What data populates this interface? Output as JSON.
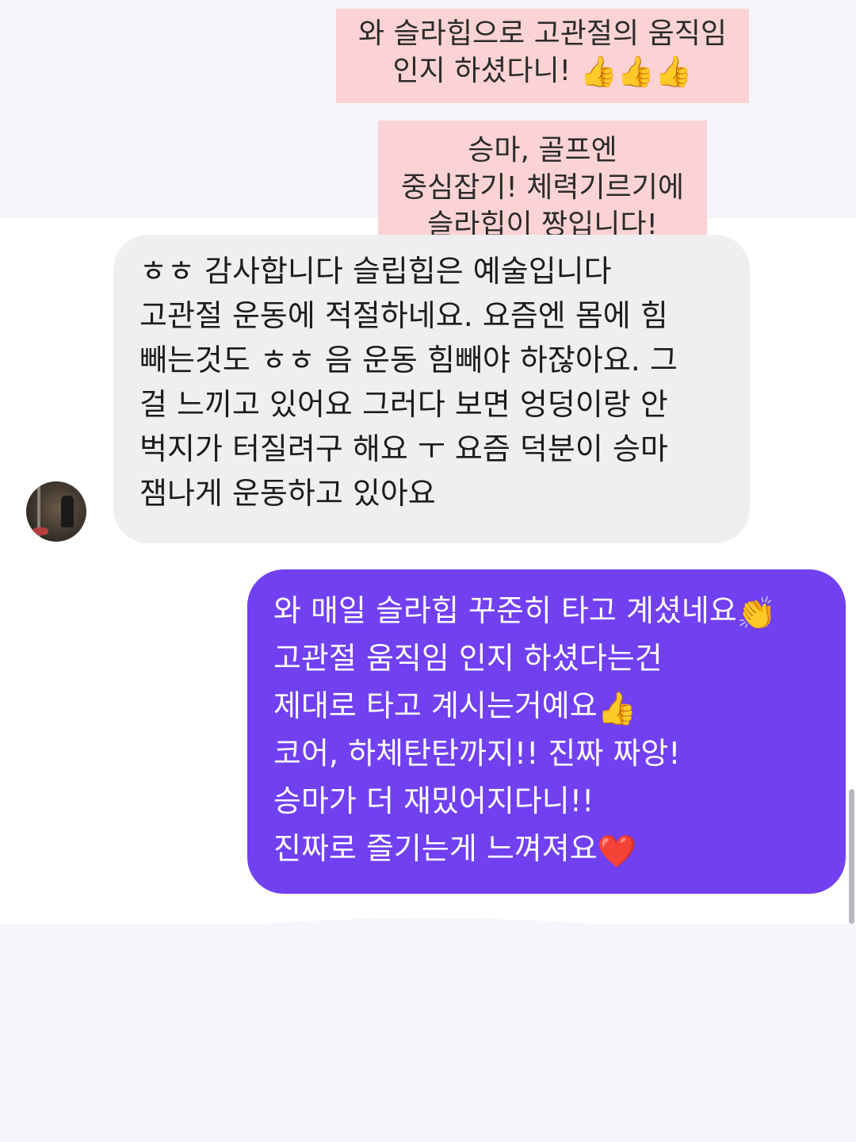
{
  "notes": [
    {
      "lines": [
        "와 슬라힙으로 고관절의 움직임",
        "인지 하셨다니!"
      ],
      "emoji": "👍👍👍"
    },
    {
      "lines": [
        "승마, 골프엔",
        "중심잡기!  체력기르기에",
        "슬라힙이 짱입니다!"
      ]
    }
  ],
  "incoming": {
    "avatar_icon": "user-avatar-photo",
    "lines": [
      "ㅎㅎ 감사합니다 슬립힙은 예술입니다",
      "고관절 운동에 적절하네요. 요즘엔 몸에 힘",
      "빼는것도 ㅎㅎ  음 운동 힘빼야 하잖아요. 그",
      "걸 느끼고 있어요 그러다 보면 엉덩이랑 안",
      "벅지가 터질려구 해요 ㅜ 요즘 덕분이 승마",
      "잼나게 운동하고 있아요"
    ]
  },
  "outgoing": {
    "lines": [
      {
        "text": "와 매일 슬라힙 꾸준히 타고 계셨네요",
        "emoji": "👏"
      },
      {
        "text": "고관절 움직임 인지 하셨다는건",
        "emoji": ""
      },
      {
        "text": "제대로 타고 계시는거예요",
        "emoji": "👍"
      },
      {
        "text": "코어, 하체탄탄까지!! 진짜 짜앙!",
        "emoji": ""
      },
      {
        "text": "승마가 더 재밌어지다니!!",
        "emoji": ""
      },
      {
        "text": "진짜로 즐기는게 느껴져요",
        "emoji": "❤️"
      }
    ]
  },
  "colors": {
    "note_bg": "#fbd3d4",
    "incoming_bg": "#efeff1",
    "outgoing_bg": "#7140f0"
  }
}
